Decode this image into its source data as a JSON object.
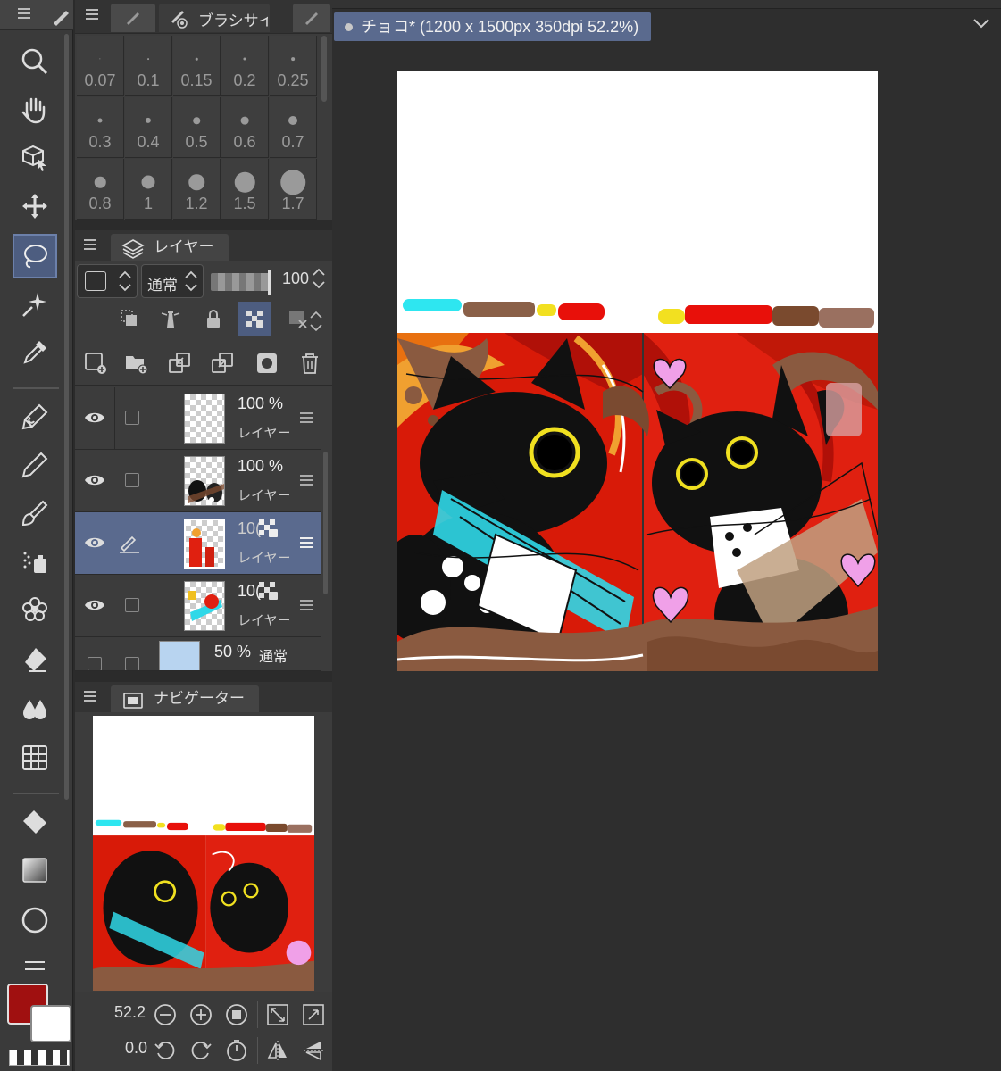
{
  "brush_panel": {
    "title": "ブラシサイ",
    "sizes": [
      "0.07",
      "0.1",
      "0.15",
      "0.2",
      "0.25",
      "0.3",
      "0.4",
      "0.5",
      "0.6",
      "0.7",
      "0.8",
      "1",
      "1.2",
      "1.5",
      "1.7"
    ]
  },
  "layer_panel": {
    "tab_label": "レイヤー",
    "blend_mode": "通常",
    "opacity": "100",
    "layers": [
      {
        "opacity": "100 %",
        "name": "レイヤー"
      },
      {
        "opacity": "100 %",
        "name": "レイヤー"
      },
      {
        "opacity": "10(",
        "name": "レイヤー"
      },
      {
        "opacity": "10(",
        "name": "レイヤー"
      },
      {
        "opacity": "50 %",
        "blend": "通常"
      }
    ]
  },
  "navigator": {
    "tab_label": "ナビゲーター",
    "zoom": "52.2",
    "rotation": "0.0"
  },
  "colors": {
    "foreground": "#a01010",
    "background": "#ffffff",
    "accent": "#5a6a8e"
  },
  "document": {
    "tab_title": "チョコ* (1200 x 1500px 350dpi 52.2%)"
  }
}
